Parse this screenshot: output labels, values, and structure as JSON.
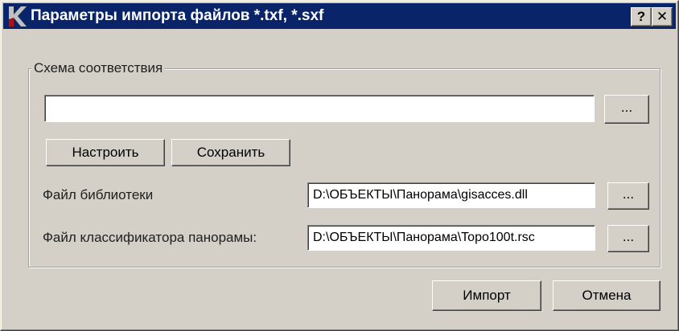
{
  "window": {
    "title": "Параметры импорта файлов *.txf, *.sxf",
    "help_label": "?",
    "close_label": "✕"
  },
  "scheme": {
    "group_title": "Схема соответствия",
    "path_value": "",
    "browse_label": "...",
    "configure_label": "Настроить",
    "save_label": "Сохранить"
  },
  "library": {
    "label": "Файл библиотеки",
    "value": "D:\\ОБЪЕКТЫ\\Панорама\\gisacces.dll",
    "browse_label": "..."
  },
  "classifier": {
    "label": "Файл классификатора панорамы:",
    "value": "D:\\ОБЪЕКТЫ\\Панорама\\Topo100t.rsc",
    "browse_label": "..."
  },
  "footer": {
    "import_label": "Импорт",
    "cancel_label": "Отмена"
  },
  "colors": {
    "titlebar": "#0a246a",
    "dialog_bg": "#d4d0c8",
    "icon_red": "#b01010"
  }
}
